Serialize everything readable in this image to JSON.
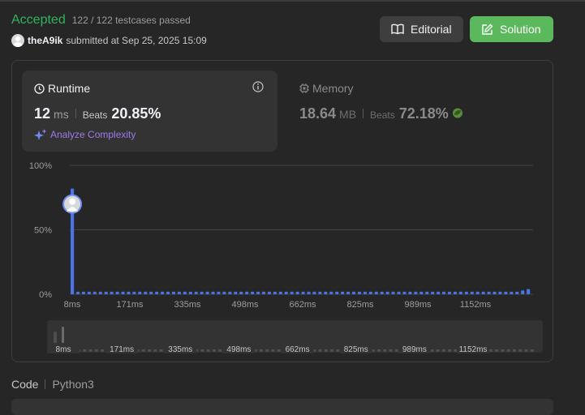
{
  "status": {
    "label": "Accepted",
    "testcases": "122 / 122 testcases passed"
  },
  "submission": {
    "user": "theA9ik",
    "text": "submitted at Sep 25, 2025 15:09"
  },
  "buttons": {
    "editorial": "Editorial",
    "solution": "Solution"
  },
  "runtime": {
    "title": "Runtime",
    "value": "12",
    "unit": "ms",
    "beats_label": "Beats",
    "beats": "20.85%",
    "analyze": "Analyze Complexity"
  },
  "memory": {
    "title": "Memory",
    "value": "18.64",
    "unit": "MB",
    "beats_label": "Beats",
    "beats": "72.18%"
  },
  "code": {
    "label": "Code",
    "language": "Python3"
  },
  "colors": {
    "accepted": "#2db55d",
    "bar": "#4a73e8",
    "solution_button": "#5cb85c",
    "analyze": "#9c7ae8"
  },
  "chart_data": {
    "type": "bar",
    "xlabel": "",
    "ylabel": "",
    "ylim": [
      0,
      100
    ],
    "y_tick_labels": [
      "100%",
      "50%",
      "0%"
    ],
    "x_tick_labels": [
      "8ms",
      "171ms",
      "335ms",
      "498ms",
      "662ms",
      "825ms",
      "989ms",
      "1152ms"
    ],
    "grid": true,
    "user_marker_bin": 0,
    "user_marker_value": 70,
    "values": [
      82,
      2,
      2,
      2,
      2,
      2,
      2,
      2,
      2,
      2,
      2,
      2,
      2,
      2,
      2,
      2,
      2,
      2,
      2,
      2,
      2,
      2,
      2,
      2,
      2,
      2,
      2,
      2,
      2,
      2,
      2,
      2,
      2,
      2,
      2,
      2,
      2,
      2,
      2,
      2,
      2,
      2,
      2,
      2,
      2,
      2,
      2,
      2,
      2,
      2,
      2,
      2,
      2,
      2,
      2,
      2,
      2,
      2,
      2,
      2,
      2,
      2,
      2,
      2,
      2,
      2,
      2,
      2,
      2,
      2,
      2,
      2,
      2,
      2,
      2,
      2,
      2,
      2,
      2,
      2,
      3,
      4
    ],
    "overview_tick_labels": [
      "8ms",
      "171ms",
      "335ms",
      "498ms",
      "662ms",
      "825ms",
      "989ms",
      "1152ms"
    ]
  }
}
